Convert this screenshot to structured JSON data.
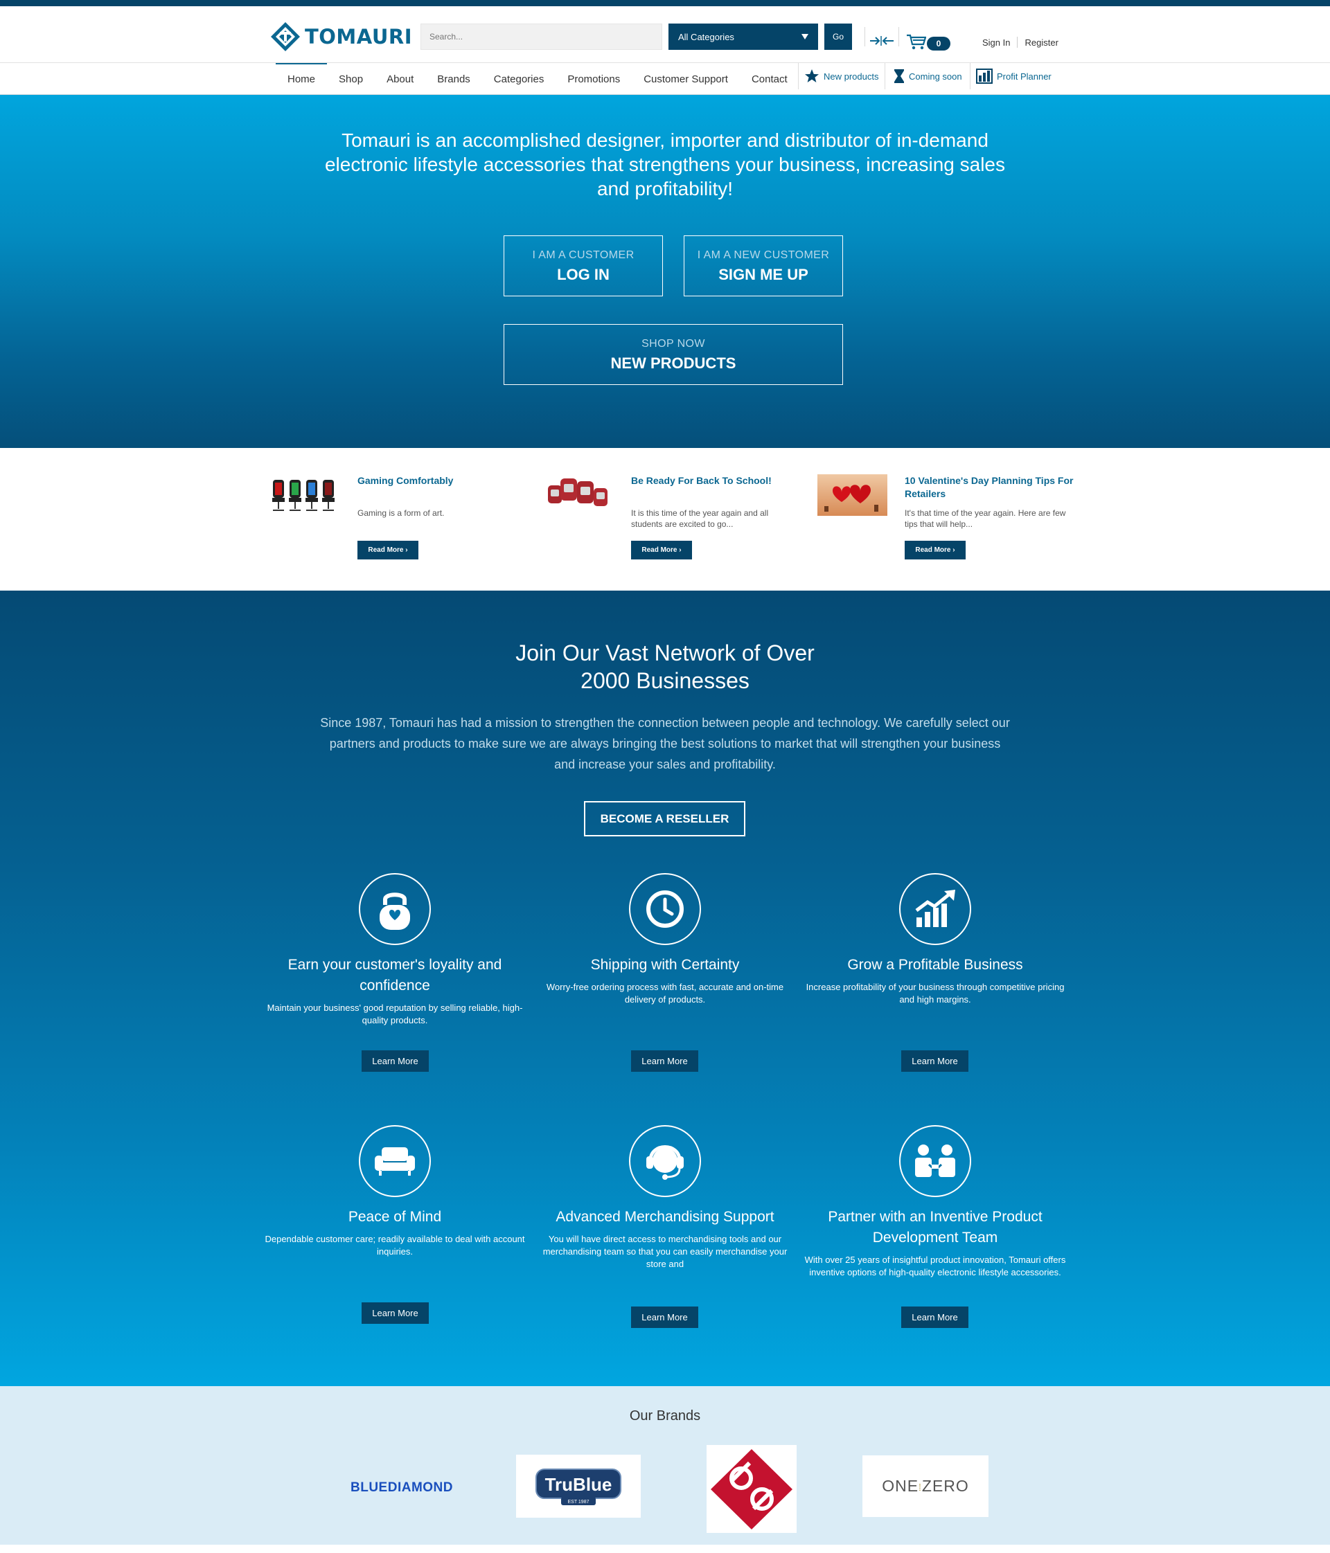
{
  "header": {
    "logo_text": "TOMAURI",
    "search_placeholder": "Search...",
    "category_label": "All Categories",
    "go_label": "Go",
    "cart_count": "0",
    "sign_in": "Sign In",
    "register": "Register"
  },
  "nav": {
    "items": [
      "Home",
      "Shop",
      "About",
      "Brands",
      "Categories",
      "Promotions",
      "Customer Support",
      "Contact"
    ],
    "new_products": "New products",
    "coming_soon": "Coming soon",
    "profit_planner": "Profit Planner"
  },
  "hero": {
    "text": "Tomauri is an accomplished designer, importer and distributor of in-demand electronic lifestyle accessories that strengthens your business, increasing sales and profitability!",
    "customer_small": "I AM A CUSTOMER",
    "customer_large": "LOG IN",
    "new_small": "I AM A NEW CUSTOMER",
    "new_large": "SIGN ME UP",
    "shop_small": "SHOP NOW",
    "shop_large": "NEW PRODUCTS"
  },
  "blog": {
    "posts": [
      {
        "title": "Gaming Comfortably",
        "excerpt": "Gaming is a form of art.",
        "button": "Read More ›"
      },
      {
        "title": "Be Ready For Back To School!",
        "excerpt": "It is this time of the year again and all students are excited to go...",
        "button": "Read More ›"
      },
      {
        "title": "10 Valentine's Day Planning Tips For Retailers",
        "excerpt": "It's that time of the year again. Here are few tips that will help...",
        "button": "Read More ›"
      }
    ]
  },
  "network": {
    "title_line1": "Join Our Vast Network of Over",
    "title_line2": "2000 Businesses",
    "description": "Since 1987, Tomauri has had a mission to strengthen the connection between people and technology. We carefully select our partners and products to make sure we are always bringing the best solutions to market that will strengthen your business and increase your sales and profitability.",
    "reseller_button": "BECOME A RESELLER",
    "features": [
      {
        "icon": "lock-heart-icon",
        "title": "Earn your customer's loyality and confidence",
        "desc": "Maintain your business' good reputation by selling reliable, high-quality products.",
        "button": "Learn More"
      },
      {
        "icon": "clock-icon",
        "title": "Shipping with Certainty",
        "desc": "Worry-free ordering process with fast, accurate and on-time delivery of products.",
        "button": "Learn More"
      },
      {
        "icon": "growth-chart-icon",
        "title": "Grow a Profitable Business",
        "desc": "Increase profitability of your business through competitive pricing and high margins.",
        "button": "Learn More"
      },
      {
        "icon": "sofa-icon",
        "title": "Peace of Mind",
        "desc": "Dependable customer care; readily available to deal with account inquiries.",
        "button": "Learn More"
      },
      {
        "icon": "headset-icon",
        "title": "Advanced Merchandising Support",
        "desc": "You will have direct access to merchandising tools and our merchandising team so that you can easily merchandise your store and",
        "button": "Learn More"
      },
      {
        "icon": "partners-icon",
        "title": "Partner with an Inventive Product Development Team",
        "desc": "With over 25 years of insightful product innovation, Tomauri offers inventive options of high-quality electronic lifestyle accessories.",
        "button": "Learn More"
      }
    ]
  },
  "brands": {
    "title": "Our Brands",
    "logos": [
      "BLUEDIAMOND",
      "TruBlue",
      "EST 1987",
      "ONE",
      "ZERO"
    ]
  },
  "colors": {
    "brand_dark": "#054468",
    "brand_link": "#0b6791",
    "hero_top": "#01a5dd"
  }
}
